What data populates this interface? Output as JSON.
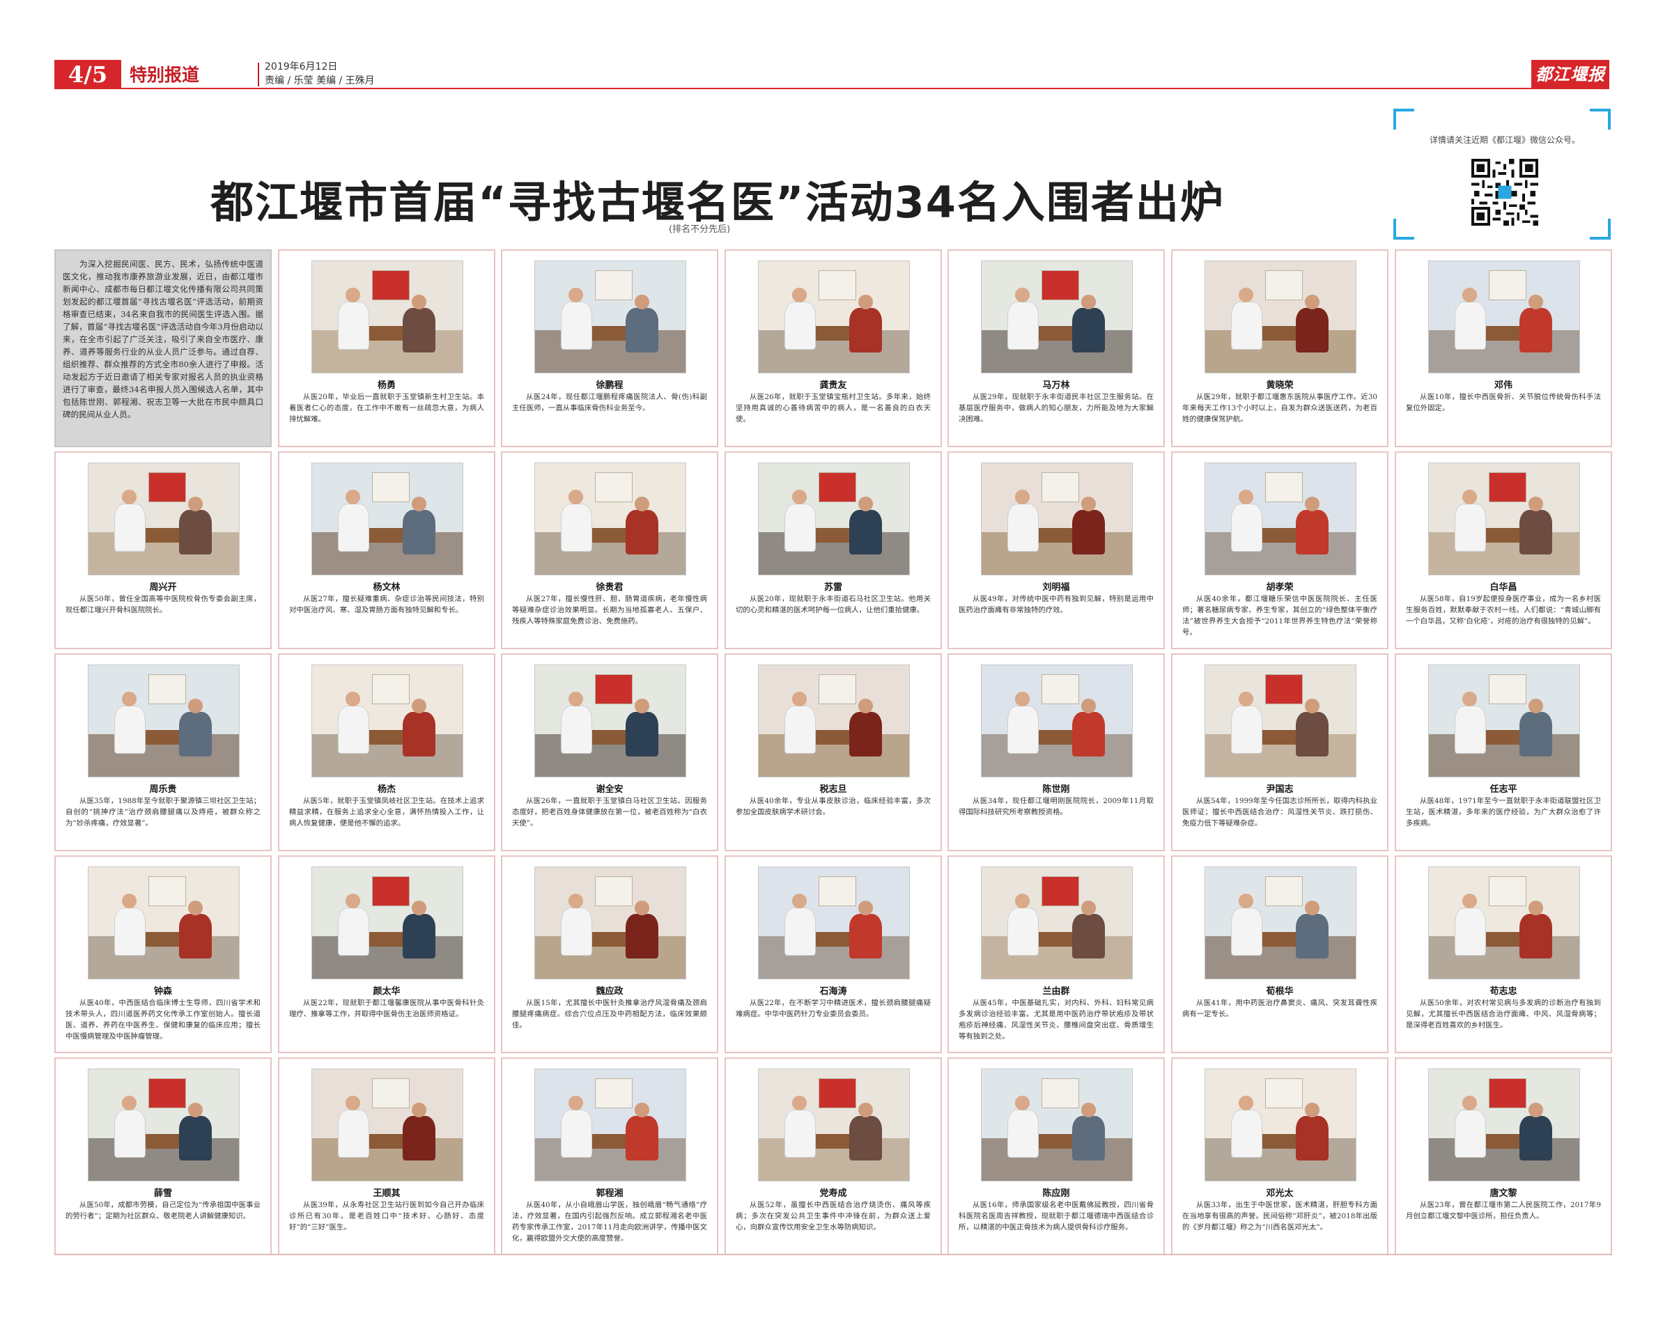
{
  "masthead": {
    "page_number": "4/5",
    "section": "特别报道",
    "date": "2019年6月12日",
    "editors": "责编 / 乐莹   美编 / 王殊月",
    "paper_name": "都江堰报",
    "brand_color": "#d7262b"
  },
  "headline": "都江堰市首届“寻找古堰名医”活动34名入围者出炉",
  "subnote": "(排名不分先后)",
  "qr_block": {
    "text": "详情请关注近期《都江堰》微信公众号。",
    "icon": "qr-code-icon"
  },
  "intro": "为深入挖掘民间医、民方、民术，弘扬传统中医道医文化，推动我市康养旅游业发展，近日，由都江堰市新闻中心、成都市每日都江堰文化传播有限公司共同策划发起的都江堰首届“寻找古堰名医”评选活动，前期资格审查已结束，34名来自我市的民间医生评选入围。据了解，首届“寻找古堰名医”评选活动自今年3月份启动以来，在全市引起了广泛关注，吸引了来自全市医疗、康养、道养等服务行业的从业人员广泛参与。通过自荐、组织推荐、群众推荐的方式全市80余人进行了申报。活动发起方于近日邀请了相关专家对报名人员的执业资格进行了审查，最终34名申报人员入围候选人名单，其中包括陈世刚、郭程湘、祝志卫等一大批在市民中颇具口碑的民间从业人员。",
  "doctors": [
    {
      "name": "杨勇",
      "desc": "从医20年，毕业后一直就职于玉堂镇新生村卫生站。本着医者仁心的态度，在工作中不敢有一丝疏忽大意，为病人排忧解难。"
    },
    {
      "name": "徐鹏程",
      "desc": "从医24年，现任都江堰鹏程疼痛医院法人、骨(伤)科副主任医师，一直从事临床骨伤科业务至今。"
    },
    {
      "name": "龚贵友",
      "desc": "从医26年，就职于玉堂镇宝瓶村卫生站。多年来，始终坚持用真诚的心善待病苦中的病人，是一名善良的白衣天使。"
    },
    {
      "name": "马万林",
      "desc": "从医29年，现就职于永丰街道民丰社区卫生服务站。在基层医疗服务中，做病人的知心朋友，力所能及地为大家解决困难。"
    },
    {
      "name": "黄晓荣",
      "desc": "从医29年，就职于都江堰惠东医院从事医疗工作。近30年来每天工作13个小时以上，自发为群众送医送药，为老百姓的健康保驾护航。"
    },
    {
      "name": "邓伟",
      "desc": "从医10年，擅长中西医骨折、关节脱位传统骨伤科手法复位外固定。"
    },
    {
      "name": "周兴开",
      "desc": "从医50年，曾任全国高等中医院校骨伤专委会副主席，现任都江堰兴开骨科医院院长。"
    },
    {
      "name": "杨文林",
      "desc": "从医27年，擅长疑难重病、杂症诊治等民间技法，特别对中医治疗风、寒、湿及胃肠方面有独特见解和专长。"
    },
    {
      "name": "徐贵君",
      "desc": "从医27年，擅长慢性肝、胆、肠胃道疾病，老年慢性病等疑难杂症诊治效果明显。长期为当地孤寡老人、五保户、残疾人等特殊家庭免费诊治、免费施药。"
    },
    {
      "name": "苏雷",
      "desc": "从医20年，现就职于永丰街道石马社区卫生站。他用关切的心灵和精湛的医术呵护每一位病人，让他们重拾健康。"
    },
    {
      "name": "刘明福",
      "desc": "从医49年，对传统中医中药有独到见解，特别是运用中医药治疗面瘫有非常独特的疗效。"
    },
    {
      "name": "胡孝荣",
      "desc": "从医40余年，都江堰糖乐荣信中医医院院长、主任医师；著名糖尿病专家、养生专家，其创立的“绿色整体平衡疗法”被世界养生大会授予“2011年世界养生特色疗法”荣誉称号。"
    },
    {
      "name": "白华昌",
      "desc": "从医58年，自19岁起便投身医疗事业，成为一名乡村医生服务百姓，默默奉献于农村一线。人们都说：“青城山脚有一个白华昌，又称‘白化疮’，对疮的治疗有很独特的见解”。"
    },
    {
      "name": "周乐贵",
      "desc": "从医35年，1988年至今就职于聚源镇三坝社区卫生站；自创的“挑抻疗法”治疗颈肩腰腿痛以及痔疮，被群众称之为“妙杀疼痛，疗效显著”。"
    },
    {
      "name": "杨杰",
      "desc": "从医5年，就职于玉堂镇凤岐社区卫生站。在技术上追求精益求精，在服务上追求全心全意，满怀热情投入工作，让病人恢复健康，便是他不懈的追求。"
    },
    {
      "name": "谢全安",
      "desc": "从医26年，一直就职于玉堂镇白马社区卫生站。因服务态度好，把老百姓身体健康放在第一位，被老百姓称为“白衣天使”。"
    },
    {
      "name": "税志旦",
      "desc": "从医40余年，专业从事皮肤诊治，临床经验丰富，多次参加全国皮肤病学术研讨会。"
    },
    {
      "name": "陈世刚",
      "desc": "从医34年，现任都江堰明刚医院院长，2009年11月取得国际科技研究所考察教授资格。"
    },
    {
      "name": "尹国志",
      "desc": "从医54年，1999年至今任国志诊所所长，取得内科执业医师证；擅长中西医结合治疗：风湿性关节炎、跌打损伤、免疫力低下等疑难杂症。"
    },
    {
      "name": "任志平",
      "desc": "从医48年，1971年至今一直就职于永丰街道联盟社区卫生站，医术精湛，多年来的医疗经验，为广大群众治愈了许多疾病。"
    },
    {
      "name": "钟森",
      "desc": "从医40年，中西医结合临床博士生导师，四川省学术和技术带头人，四川道医养药文化传承工作室创始人。擅长道医、道养、养药在中医养生、保健和康复的临床应用；擅长中医慢病管理及中医肿瘤管理。"
    },
    {
      "name": "颜太华",
      "desc": "从医22年，现就职于都江堰馨康医院从事中医骨科针灸理疗、推拿等工作，并取得中医骨伤主治医师资格证。"
    },
    {
      "name": "魏应政",
      "desc": "从医15年，尤其擅长中医针灸推拿治疗风湿骨痛及颈肩腰腿疼痛病症。综合穴位点压及中药相配方法，临床效果颇佳。"
    },
    {
      "name": "石海涛",
      "desc": "从医22年，在不断学习中精进医术，擅长颈肩腰腿痛疑难病症。中华中医药针刀专业委员会委员。"
    },
    {
      "name": "兰由群",
      "desc": "从医45年，中医基础扎实，对内科、外科、妇科常见病多发病诊治经验丰富。尤其是用中医药治疗带状疱疹及带状疱疹后神经痛、风湿性关节炎、腰椎间盘突出症、骨质增生等有独到之处。"
    },
    {
      "name": "荀根华",
      "desc": "从医41年，用中药医治疗鼻窦炎、痛风、突发耳聋性疾病有一定专长。"
    },
    {
      "name": "苟志忠",
      "desc": "从医50余年，对农村常见病与多发病的诊断治疗有独到见解，尤其擅长中西医结合治疗面瘫、中风、风湿骨病等；是深得老百姓喜欢的乡村医生。"
    },
    {
      "name": "薛雪",
      "desc": "从医50年，成都市劳模，自己定位为“传承祖国中医事业的劳行者”；定期为社区群众、敬老院老人讲解健康知识。"
    },
    {
      "name": "王顺其",
      "desc": "从医39年，从永寿社区卫生站行医到如今自己开办临床诊所已有30年。是老百姓口中“技术好、心肠好、态度好”的“三好”医生。"
    },
    {
      "name": "郭程湘",
      "desc": "从医40年，从小自峨眉山学医，独创峨眉“畅气通络”疗法，疗效显著，在国内引起强烈反响。成立郭程湘名老中医药专家传承工作室，2017年11月走向欧洲讲学，传播中医文化，赢得欧盟外交大使的高度赞誉。"
    },
    {
      "name": "党寿成",
      "desc": "从医52年，虽擅长中西医结合治疗烧烫伤、痛风等疾病；多次在突发公共卫生事件中冲锋在前，为群众送上爱心，向群众宣传饮用安全卫生水等防病知识。"
    },
    {
      "name": "陈应刚",
      "desc": "从医16年，师承国家级名老中医戴佛延教授，四川省骨科医院名医周吉祥教授，现就职于都江堰德瑞中西医结合诊所，以精湛的中医正骨技术为病人提供骨科诊疗服务。"
    },
    {
      "name": "邓光太",
      "desc": "从医33年，出生于中医世家，医术精湛，肝胆专科方面在当地享有很高的声誉。民间俗称“邓肝炎”，被2018年出版的《岁月都江堰》称之为“川西名医邓光太”。"
    },
    {
      "name": "唐文黎",
      "desc": "从医23年，曾在都江堰市第二人民医院工作，2017年9月创立都江堰文黎中医诊所，担任负责人。"
    }
  ]
}
